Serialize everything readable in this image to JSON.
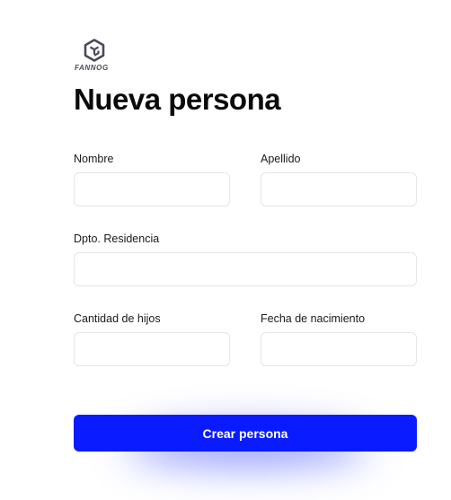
{
  "brand": {
    "name": "FANNOG",
    "logo_icon": "hexagon-logo-icon",
    "logo_color": "#4a4a5a"
  },
  "page": {
    "title": "Nueva persona"
  },
  "form": {
    "nombre": {
      "label": "Nombre",
      "value": "",
      "placeholder": ""
    },
    "apellido": {
      "label": "Apellido",
      "value": "",
      "placeholder": ""
    },
    "dpto_residencia": {
      "label": "Dpto. Residencia",
      "value": "",
      "placeholder": ""
    },
    "cantidad_hijos": {
      "label": "Cantidad de hijos",
      "value": "",
      "placeholder": ""
    },
    "fecha_nacimiento": {
      "label": "Fecha de nacimiento",
      "value": "",
      "placeholder": ""
    },
    "submit_label": "Crear persona"
  },
  "colors": {
    "accent": "#0a1cff",
    "input_border": "#e6e6ea",
    "text": "#111111"
  }
}
